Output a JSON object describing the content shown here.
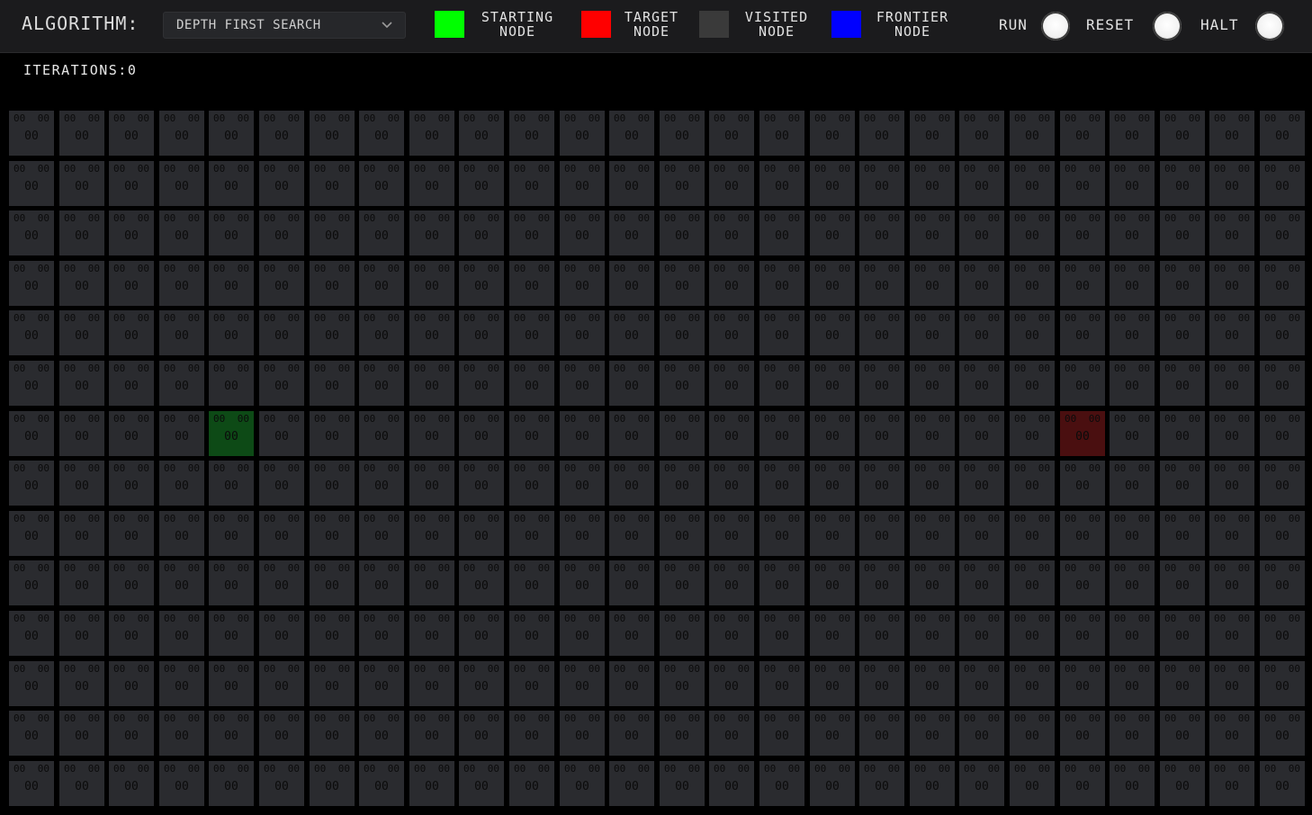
{
  "header": {
    "algorithm_label": "ALGORITHM:",
    "algorithm_selected": "DEPTH FIRST SEARCH",
    "algorithm_icon": "chevron-down-icon"
  },
  "legend": [
    {
      "label": "STARTING\nNODE",
      "color": "#00ff00"
    },
    {
      "label": "TARGET\nNODE",
      "color": "#ff0000"
    },
    {
      "label": "VISITED\nNODE",
      "color": "#3a3a3a"
    },
    {
      "label": "FRONTIER\nNODE",
      "color": "#0000ff"
    }
  ],
  "controls": {
    "run_label": "RUN",
    "reset_label": "RESET",
    "halt_label": "HALT"
  },
  "status": {
    "iterations_text": "ITERATIONS:0"
  },
  "grid": {
    "rows": 14,
    "cols": 26,
    "cell_value_text": "00",
    "start": {
      "row": 6,
      "col": 4
    },
    "target": {
      "row": 6,
      "col": 21
    },
    "colors": {
      "empty": "#2a2b2f",
      "start": "#0d4a16",
      "target": "#4a0f10"
    }
  }
}
